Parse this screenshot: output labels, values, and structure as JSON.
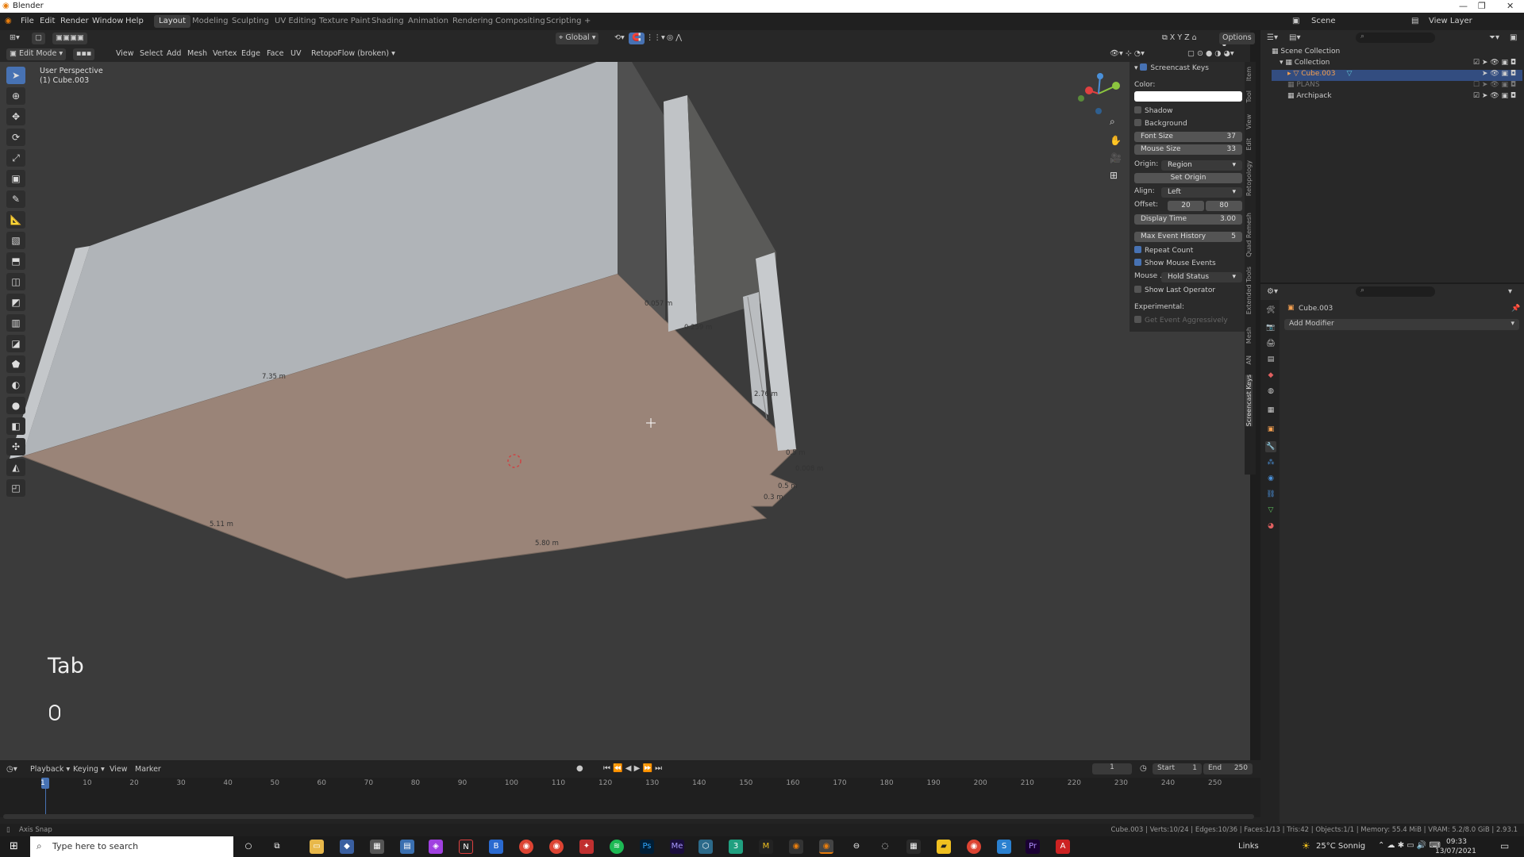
{
  "window": {
    "title": "Blender"
  },
  "menu": {
    "items": [
      "File",
      "Edit",
      "Render",
      "Window",
      "Help"
    ]
  },
  "workspaces": [
    "Layout",
    "Modeling",
    "Sculpting",
    "UV Editing",
    "Texture Paint",
    "Shading",
    "Animation",
    "Rendering",
    "Compositing",
    "Scripting",
    "+"
  ],
  "header": {
    "transform": "Global",
    "options": "Options",
    "mode": "Edit Mode",
    "menus": [
      "View",
      "Select",
      "Add",
      "Mesh",
      "Vertex",
      "Edge",
      "Face",
      "UV"
    ],
    "addon": "RetopoFlow (broken)"
  },
  "viewport": {
    "perspective": "User Perspective",
    "object": "(1) Cube.003",
    "key_overlay": "Tab",
    "dimensions": [
      "0.057 m",
      "0.259 m",
      "7.35 m",
      "2.76 m",
      "0.5 m",
      "0.008 m",
      "0.5 m",
      "0.3 m",
      "5.11 m",
      "5.80 m"
    ]
  },
  "npanel": {
    "title": "Screencast Keys",
    "color_label": "Color:",
    "shadow": "Shadow",
    "background": "Background",
    "font_size_label": "Font Size",
    "font_size": "37",
    "mouse_size_label": "Mouse Size",
    "mouse_size": "33",
    "origin_label": "Origin:",
    "origin": "Region",
    "set_origin": "Set Origin",
    "align_label": "Align:",
    "align": "Left",
    "offset_label": "Offset:",
    "offset_x": "20",
    "offset_y": "80",
    "display_time_label": "Display Time",
    "display_time": "3.00",
    "max_event_label": "Max Event History",
    "max_event": "5",
    "repeat_count": "Repeat Count",
    "show_mouse": "Show Mouse Events",
    "mouse_label": "Mouse ...",
    "mouse_value": "Hold Status",
    "show_last": "Show Last Operator",
    "experimental": "Experimental:",
    "get_event": "Get Event Aggressively"
  },
  "sidebar_tabs": [
    "Item",
    "Tool",
    "View",
    "Edit",
    "Retopology",
    "Quad Remesh",
    "Extended Tools",
    "Mesh",
    "AN",
    "Screencast Keys"
  ],
  "topbar_right": {
    "scene": "Scene",
    "view_layer": "View Layer"
  },
  "outliner": {
    "rows": [
      "Scene Collection",
      "Collection",
      "Cube.003",
      "PLANS",
      "Archipack"
    ]
  },
  "properties": {
    "object": "Cube.003",
    "add_modifier": "Add Modifier"
  },
  "timeline": {
    "menus": [
      "Playback",
      "Keying",
      "View",
      "Marker"
    ],
    "current": "1",
    "start_label": "Start",
    "start": "1",
    "end_label": "End",
    "end": "250",
    "ticks": [
      "1",
      "10",
      "20",
      "30",
      "40",
      "50",
      "60",
      "70",
      "80",
      "90",
      "100",
      "110",
      "120",
      "130",
      "140",
      "150",
      "160",
      "170",
      "180",
      "190",
      "200",
      "210",
      "220",
      "230",
      "240",
      "250"
    ]
  },
  "status": {
    "left": "Axis Snap",
    "right": "Cube.003 | Verts:10/24 | Edges:10/36 | Faces:1/13 | Tris:42 | Objects:1/1 | Memory: 55.4 MiB | VRAM: 5.2/8.0 GiB | 2.93.1"
  },
  "taskbar": {
    "search": "Type here to search",
    "links": "Links",
    "weather": "25°C Sonnig",
    "time": "09:33",
    "date": "13/07/2021"
  },
  "colors": {
    "accent": "#4772b3",
    "wall": "#b0b4b8",
    "floor": "#9a8478"
  }
}
